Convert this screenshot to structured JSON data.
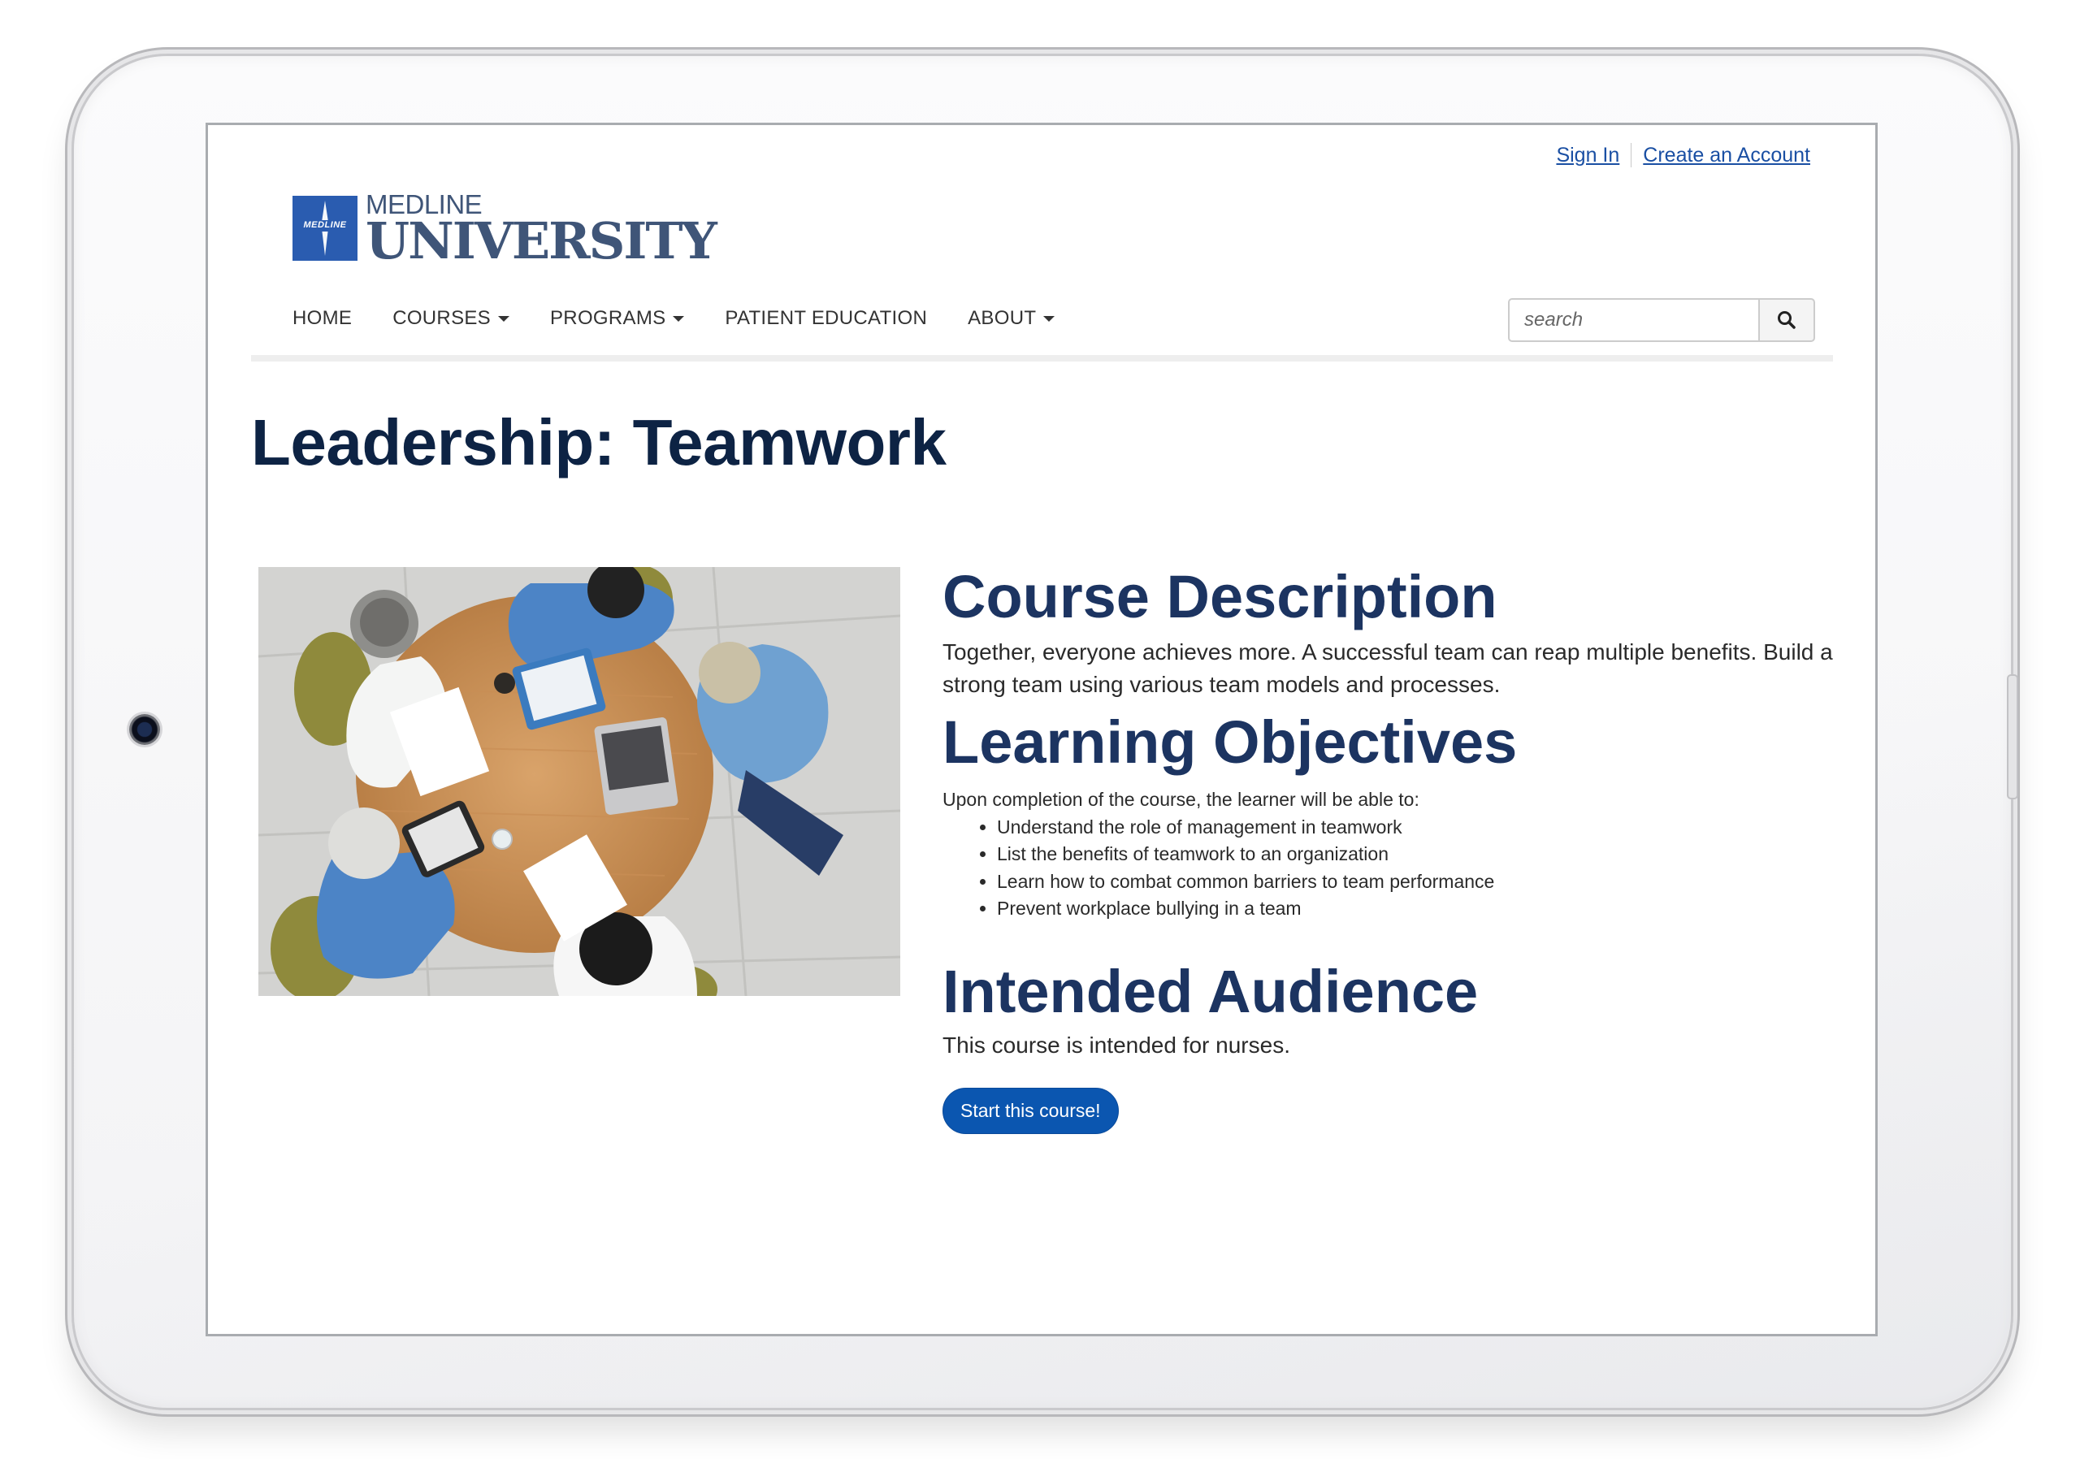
{
  "header": {
    "sign_in": "Sign In",
    "create_account": "Create an Account"
  },
  "logo": {
    "mark_text": "MEDLINE",
    "line1": "MEDLINE",
    "line2": "UNIVERSITY"
  },
  "nav": {
    "items": [
      {
        "label": "HOME",
        "dropdown": false
      },
      {
        "label": "COURSES",
        "dropdown": true
      },
      {
        "label": "PROGRAMS",
        "dropdown": true
      },
      {
        "label": "PATIENT EDUCATION",
        "dropdown": false
      },
      {
        "label": "ABOUT",
        "dropdown": true
      }
    ]
  },
  "search": {
    "placeholder": "search",
    "icon": "search-icon"
  },
  "page": {
    "title": "Leadership: Teamwork"
  },
  "course": {
    "description_heading": "Course Description",
    "description_text": "Together, everyone achieves more. A successful team can reap multiple benefits. Build a strong team using various team models and processes.",
    "objectives_heading": "Learning Objectives",
    "objectives_intro": "Upon completion of the course, the learner will be able to:",
    "objectives": [
      "Understand the role of management in teamwork",
      "List the benefits of teamwork to an organization",
      "Learn how to combat common barriers to team performance",
      "Prevent workplace bullying in a team"
    ],
    "audience_heading": "Intended Audience",
    "audience_text": "This course is intended for nurses.",
    "start_button": "Start this course!"
  },
  "colors": {
    "brand_blue": "#2a5cb0",
    "heading_navy": "#1c3461",
    "title_navy": "#0d2344",
    "button_blue": "#0b56b0",
    "link_blue": "#1a4fa3"
  }
}
